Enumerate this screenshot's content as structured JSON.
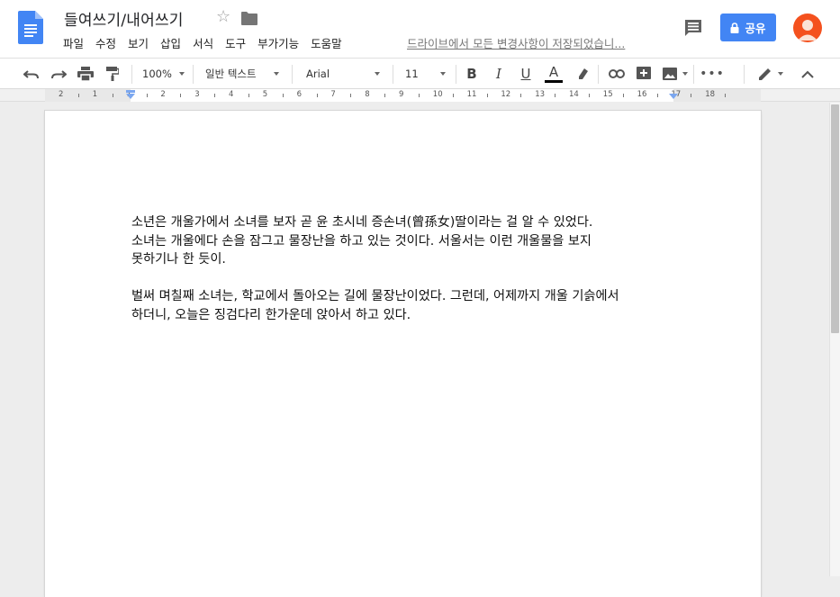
{
  "app": {
    "doc_title": "들여쓰기/내어쓰기",
    "save_status": "드라이브에서 모든 변경사항이 저장되었습니...",
    "share_label": "공유"
  },
  "menu": [
    {
      "label": "파일"
    },
    {
      "label": "수정"
    },
    {
      "label": "보기"
    },
    {
      "label": "삽입"
    },
    {
      "label": "서식"
    },
    {
      "label": "도구"
    },
    {
      "label": "부가기능"
    },
    {
      "label": "도움말"
    }
  ],
  "toolbar": {
    "zoom": "100%",
    "style": "일반 텍스트",
    "font": "Arial",
    "size": "11"
  },
  "ruler": {
    "labels": [
      "2",
      "1",
      "1",
      "2",
      "3",
      "4",
      "5",
      "6",
      "7",
      "8",
      "9",
      "10",
      "11",
      "12",
      "13",
      "14",
      "15",
      "16",
      "17",
      "18"
    ]
  },
  "document": {
    "paragraphs": [
      {
        "lines": [
          "소년은 개울가에서 소녀를 보자 곧 윤 초시네 증손녀(曾孫女)딸이라는 걸 알 수 있었다.",
          "소녀는 개울에다 손을 잠그고 물장난을 하고 있는 것이다. 서울서는 이런 개울물을 보지",
          "못하기나 한 듯이."
        ]
      },
      {
        "lines": [
          "벌써 며칠째 소녀는, 학교에서 돌아오는 길에 물장난이었다. 그런데, 어제까지 개울 기슭에서",
          "하더니, 오늘은 징검다리 한가운데 앉아서 하고 있다."
        ]
      }
    ]
  },
  "colors": {
    "accent": "#4285f4",
    "avatar": "#f4511e",
    "doc_icon": "#4285f4"
  }
}
